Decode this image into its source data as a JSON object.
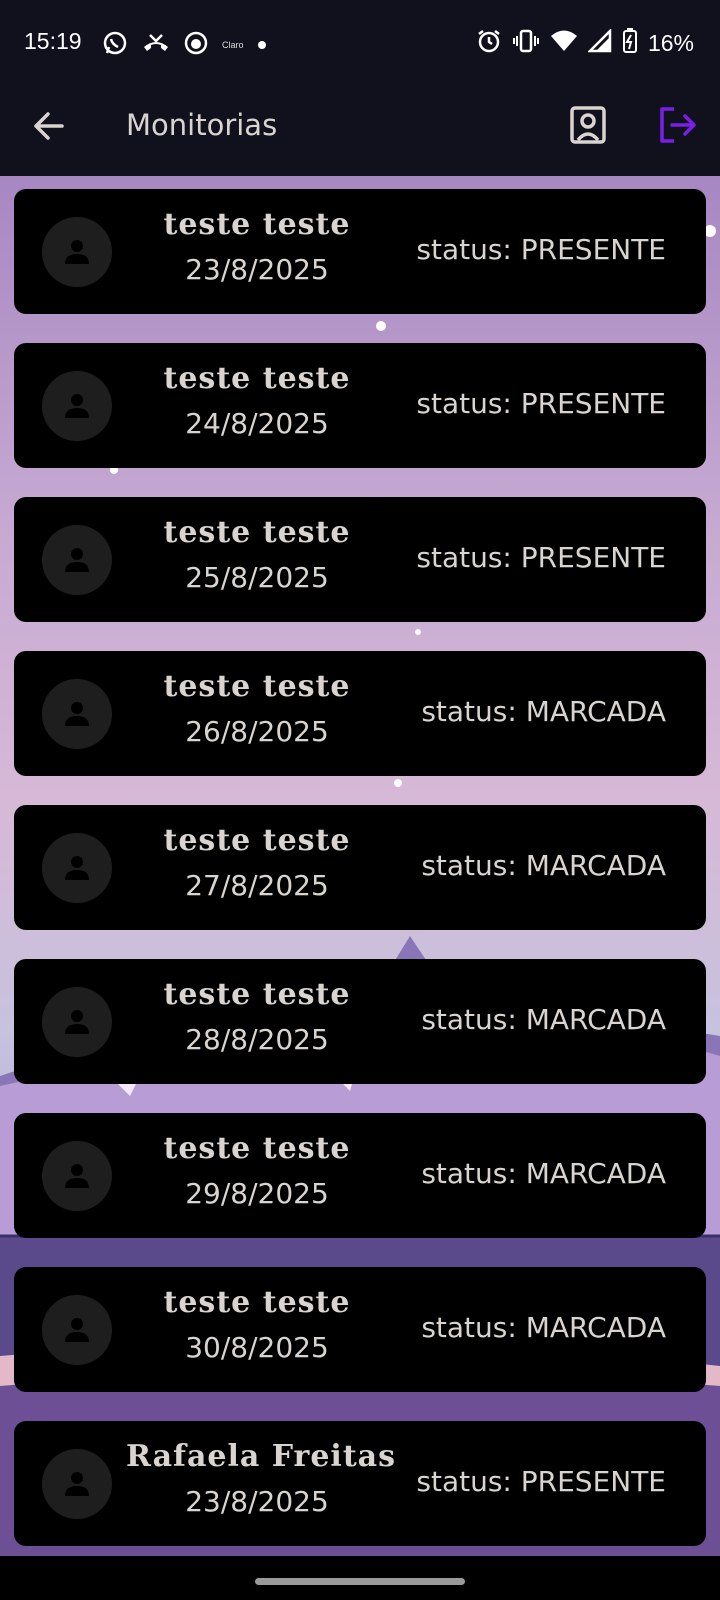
{
  "status_bar": {
    "time": "15:19",
    "carrier": "Claro",
    "battery": "16%",
    "notification_icons": [
      "whatsapp-icon",
      "missed-call-icon",
      "app-icon",
      "carrier-icon",
      "dot-icon"
    ],
    "system_icons": [
      "alarm-icon",
      "vibrate-icon",
      "wifi-icon",
      "signal-icon",
      "battery-charging-icon"
    ]
  },
  "app_bar": {
    "title": "Monitorias",
    "accent_color": "#7a1fe6"
  },
  "monitorias": [
    {
      "name": "teste  teste",
      "date": "23/8/2025",
      "status": "status: PRESENTE"
    },
    {
      "name": "teste  teste",
      "date": "24/8/2025",
      "status": "status: PRESENTE"
    },
    {
      "name": "teste  teste",
      "date": "25/8/2025",
      "status": "status: PRESENTE"
    },
    {
      "name": "teste  teste",
      "date": "26/8/2025",
      "status": "status: MARCADA"
    },
    {
      "name": "teste  teste",
      "date": "27/8/2025",
      "status": "status: MARCADA"
    },
    {
      "name": "teste  teste",
      "date": "28/8/2025",
      "status": "status: MARCADA"
    },
    {
      "name": "teste  teste",
      "date": "29/8/2025",
      "status": "status: MARCADA"
    },
    {
      "name": "teste  teste",
      "date": "30/8/2025",
      "status": "status: MARCADA"
    },
    {
      "name": "Rafaela Freitas",
      "date": "23/8/2025",
      "status": "status: PRESENTE"
    }
  ]
}
